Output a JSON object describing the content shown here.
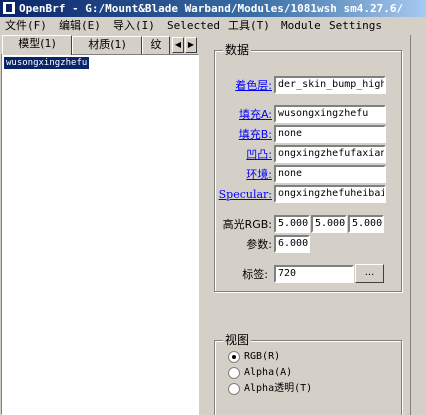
{
  "window": {
    "title": "OpenBrf - G:/Mount&Blade Warband/Modules/1081wsh sm4.27.6/"
  },
  "menu": [
    {
      "label": "文件(F)"
    },
    {
      "label": "编辑(E)"
    },
    {
      "label": "导入(I)"
    },
    {
      "label": "Selected"
    },
    {
      "label": "工具(T)"
    },
    {
      "label": "Module"
    },
    {
      "label": "Settings"
    }
  ],
  "left_panel": {
    "tabs": [
      {
        "label": "模型(1)"
      },
      {
        "label": "材质(1)"
      },
      {
        "label": "纹"
      }
    ],
    "scroll_left": "◀",
    "scroll_right": "▶",
    "list_items": [
      {
        "label": "wusongxingzhefu"
      }
    ]
  },
  "data_group": {
    "title": "数据",
    "shader": {
      "label": "着色层:",
      "value": "der_skin_bump_high"
    },
    "fill_a": {
      "label": "填充A:",
      "value": "wusongxingzhefu"
    },
    "fill_b": {
      "label": "填充B:",
      "value": "none"
    },
    "bump": {
      "label": "凹凸:",
      "value": "ongxingzhefufaxian"
    },
    "env": {
      "label": "环境:",
      "value": "none"
    },
    "specular": {
      "label": "Specular:",
      "value": "ongxingzhefuheibai"
    },
    "spec_rgb": {
      "label": "高光RGB:",
      "r": "5.000",
      "g": "5.000",
      "b": "5.000"
    },
    "params": {
      "label": "参数:",
      "value": "6.000"
    },
    "tag": {
      "label": "标签:",
      "value": "720",
      "button": "..."
    }
  },
  "view_group": {
    "title": "视图",
    "options": [
      {
        "label": "RGB(R)",
        "checked": true
      },
      {
        "label": "Alpha(A)",
        "checked": false
      },
      {
        "label": "Alpha透明(T)",
        "checked": false
      }
    ]
  }
}
